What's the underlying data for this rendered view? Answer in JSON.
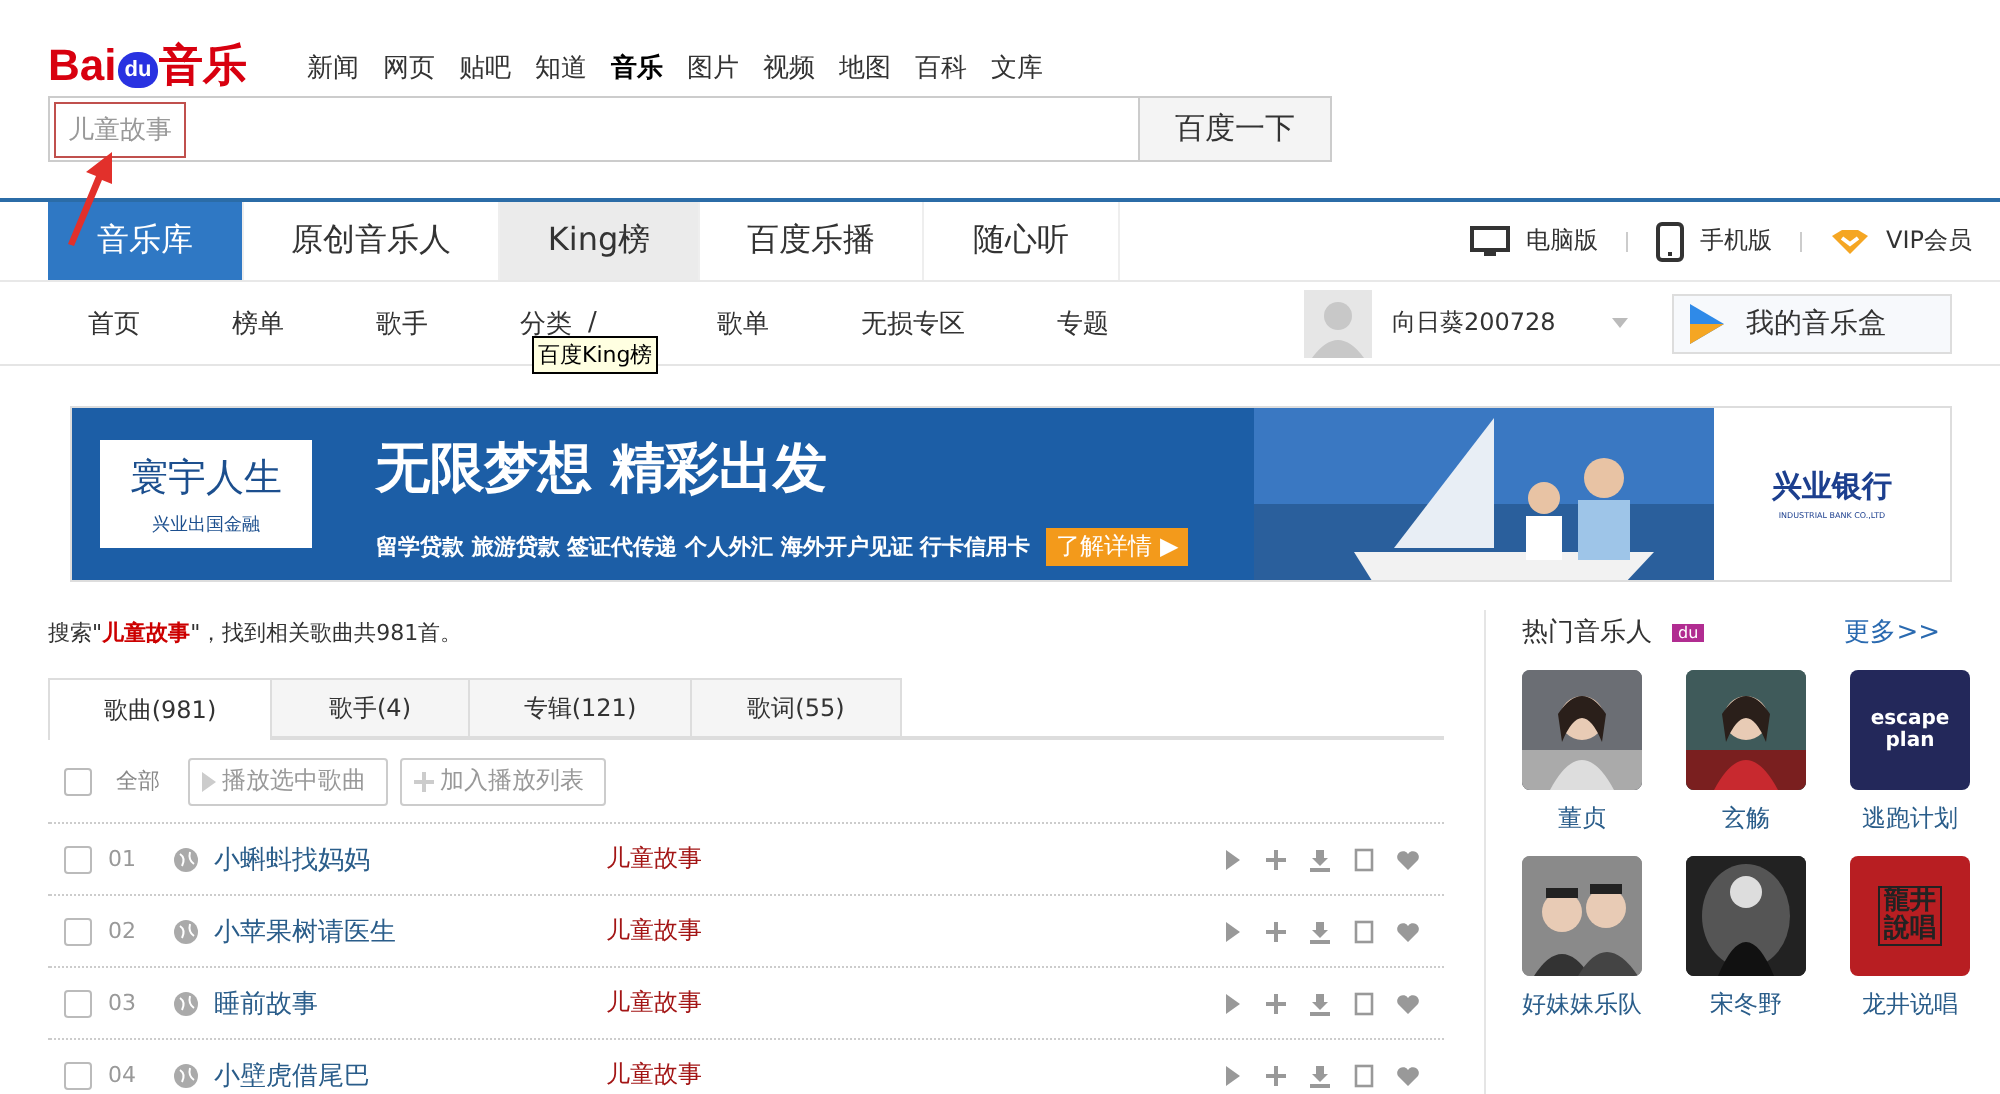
{
  "logo": {
    "text_left": "Bai",
    "text_mark": "du",
    "text_right": "音乐"
  },
  "top_links": [
    {
      "label": "新闻",
      "selected": false
    },
    {
      "label": "网页",
      "selected": false
    },
    {
      "label": "贴吧",
      "selected": false
    },
    {
      "label": "知道",
      "selected": false
    },
    {
      "label": "音乐",
      "selected": true
    },
    {
      "label": "图片",
      "selected": false
    },
    {
      "label": "视频",
      "selected": false
    },
    {
      "label": "地图",
      "selected": false
    },
    {
      "label": "百科",
      "selected": false
    },
    {
      "label": "文库",
      "selected": false
    }
  ],
  "search": {
    "value": "儿童故事",
    "button": "百度一下",
    "highlighted": true
  },
  "main_tabs": [
    {
      "label": "音乐库",
      "selected": true,
      "hover": false
    },
    {
      "label": "原创音乐人",
      "selected": false,
      "hover": false
    },
    {
      "label": "King榜",
      "selected": false,
      "hover": true
    },
    {
      "label": "百度乐播",
      "selected": false,
      "hover": false
    },
    {
      "label": "随心听",
      "selected": false,
      "hover": false
    }
  ],
  "right_links": [
    {
      "kind": "desktop",
      "label": "电脑版"
    },
    {
      "kind": "phone",
      "label": "手机版"
    },
    {
      "kind": "vip",
      "label": "VIP会员"
    }
  ],
  "sub_nav": [
    "首页",
    "榜单",
    "歌手",
    "分类",
    "/",
    "歌单",
    "无损专区",
    "专题"
  ],
  "tooltip": "百度King榜",
  "user": {
    "name": "向日葵200728",
    "music_box": "我的音乐盒"
  },
  "banner": {
    "brand_title": "寰宇人生",
    "brand_sub": "兴业出国金融",
    "headline": "无限梦想 精彩出发",
    "services": "留学贷款 旅游贷款 签证代传递 个人外汇 海外开户见证 行卡信用卡",
    "cta": "了解详情 ▶",
    "bank": "兴业银行",
    "bank_en": "INDUSTRIAL BANK CO.,LTD"
  },
  "result": {
    "prefix": "搜索\"",
    "query": "儿童故事",
    "suffix": "\"，找到相关歌曲共981首。"
  },
  "result_tabs": [
    {
      "label": "歌曲(981)",
      "selected": true
    },
    {
      "label": "歌手(4)",
      "selected": false
    },
    {
      "label": "专辑(121)",
      "selected": false
    },
    {
      "label": "歌词(55)",
      "selected": false
    }
  ],
  "toolbar": {
    "select_all": "全部",
    "checked": false,
    "play": "播放选中歌曲",
    "add": "加入播放列表"
  },
  "songs": [
    {
      "num": "01",
      "title": "小蝌蚪找妈妈",
      "artist": "儿童故事",
      "checked": false
    },
    {
      "num": "02",
      "title": "小苹果树请医生",
      "artist": "儿童故事",
      "checked": false
    },
    {
      "num": "03",
      "title": "睡前故事",
      "artist": "儿童故事",
      "checked": false
    },
    {
      "num": "04",
      "title": "小壁虎借尾巴",
      "artist": "儿童故事",
      "checked": false
    }
  ],
  "hot_artists": {
    "title": "热门音乐人",
    "badge": "du",
    "more": "更多>>",
    "items": [
      {
        "name": "董贞",
        "kind": "picture",
        "color": "#6b6e74"
      },
      {
        "name": "玄觞",
        "kind": "picture",
        "color": "#3f5a5a"
      },
      {
        "name": "逃跑计划",
        "kind": "logo",
        "logo_text": "escape plan",
        "color": "#23285a"
      },
      {
        "name": "好妹妹乐队",
        "kind": "picture",
        "color": "#8a8a8a"
      },
      {
        "name": "宋冬野",
        "kind": "picture",
        "color": "#222222"
      },
      {
        "name": "龙井说唱",
        "kind": "logo",
        "logo_text": "龍井說唱",
        "color": "#b81e22"
      }
    ]
  }
}
